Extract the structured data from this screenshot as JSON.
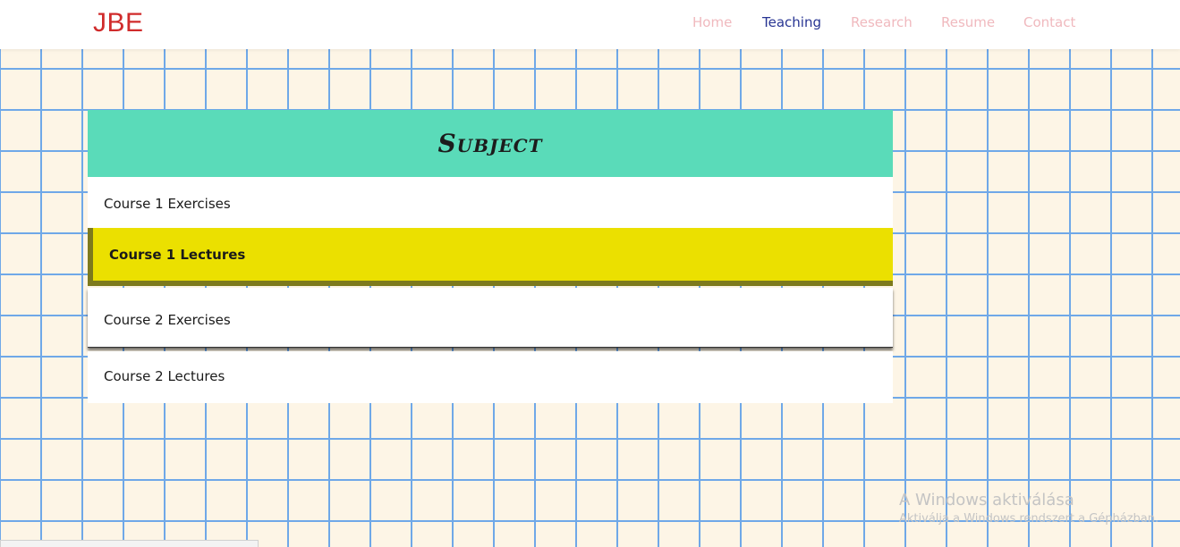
{
  "brand": "JBE",
  "nav": {
    "items": [
      {
        "label": "Home",
        "active": false
      },
      {
        "label": "Teaching",
        "active": true
      },
      {
        "label": "Research",
        "active": false
      },
      {
        "label": "Resume",
        "active": false
      },
      {
        "label": "Contact",
        "active": false
      }
    ]
  },
  "panel": {
    "title": "Subject",
    "courses": [
      {
        "label": "Course 1 Exercises"
      },
      {
        "label": "Course 1 Lectures"
      },
      {
        "label": "Course 2 Exercises"
      },
      {
        "label": "Course 2 Lectures"
      }
    ]
  },
  "watermark": {
    "title": "A Windows aktiválása",
    "subtitle": "Aktiválja a Windows rendszert a Gépházban."
  },
  "colors": {
    "brand": "#d02b2b",
    "nav_active": "#283593",
    "nav_inactive": "#f0b9be",
    "header_bg": "#5adbb9",
    "highlight_bg": "#ebe000",
    "grid_line": "#6fa8e8",
    "page_bg": "#fdf5e6"
  }
}
